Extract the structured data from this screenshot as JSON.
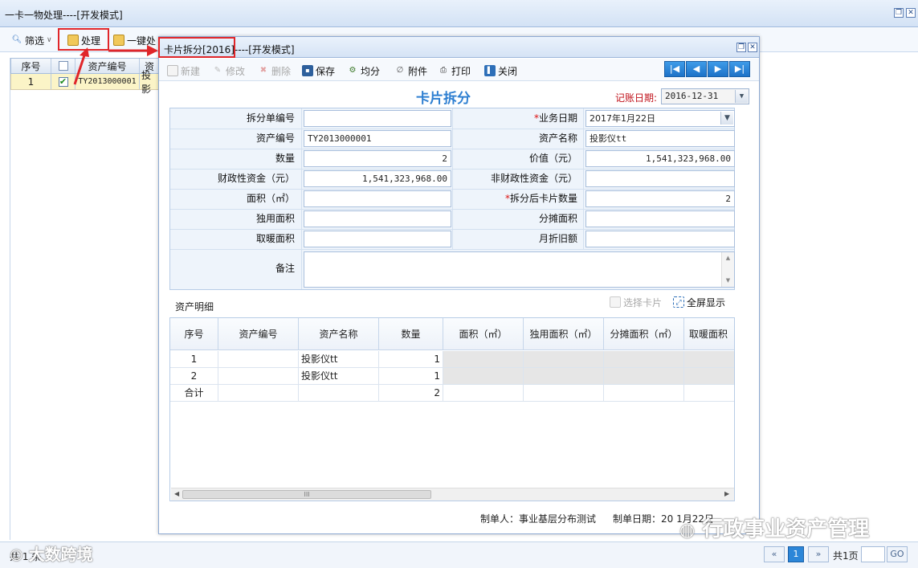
{
  "bg_window": {
    "title": "一卡一物处理----[开发模式]",
    "toolbar": {
      "filter": "筛选",
      "process": "处理",
      "batch": "一键处"
    },
    "grid": {
      "headers": [
        "序号",
        "",
        "资产编号",
        "资"
      ],
      "row": {
        "index": "1",
        "asset_no": "TY2013000001",
        "name": "投影"
      }
    },
    "status": {
      "count": "共 1 条",
      "page": "1",
      "total_pages": "共1页",
      "go": "GO"
    }
  },
  "modal": {
    "title": "卡片拆分[2016]----[开发模式]",
    "toolbar": {
      "new": "新建",
      "edit": "修改",
      "delete": "删除",
      "save": "保存",
      "split_even": "均分",
      "attachment": "附件",
      "print": "打印",
      "close": "关闭"
    },
    "heading": "卡片拆分",
    "record_date_label": "记账日期:",
    "record_date": "2016-12-31",
    "form": {
      "split_no_label": "拆分单编号",
      "split_no": "",
      "biz_date_label": "业务日期",
      "biz_date": "2017年1月22日",
      "asset_no_label": "资产编号",
      "asset_no": "TY2013000001",
      "asset_name_label": "资产名称",
      "asset_name": "投影仪tt",
      "qty_label": "数量",
      "qty": "2",
      "value_label": "价值（元）",
      "value": "1,541,323,968.00",
      "fiscal_label": "财政性资金（元）",
      "fiscal": "1,541,323,968.00",
      "nonfiscal_label": "非财政性资金（元）",
      "nonfiscal": "",
      "area_label": "面积（㎡）",
      "area": "",
      "split_count_label": "拆分后卡片数量",
      "split_count": "2",
      "own_area_label": "独用面积",
      "own_area": "",
      "shared_area_label": "分摊面积",
      "shared_area": "",
      "heat_area_label": "取暖面积",
      "heat_area": "",
      "monthly_dep_label": "月折旧额",
      "monthly_dep": "",
      "remark_label": "备注",
      "remark": ""
    },
    "detail": {
      "title": "资产明细",
      "select_card": "选择卡片",
      "fullscreen": "全屏显示",
      "headers": [
        "序号",
        "资产编号",
        "资产名称",
        "数量",
        "面积（㎡）",
        "独用面积（㎡）",
        "分摊面积（㎡）",
        "取暖面积（"
      ],
      "rows": [
        {
          "index": "1",
          "asset_no": "",
          "name": "投影仪tt",
          "qty": "1"
        },
        {
          "index": "2",
          "asset_no": "",
          "name": "投影仪tt",
          "qty": "1"
        }
      ],
      "total": {
        "label": "合计",
        "qty": "2"
      },
      "scroll_thumb": "III"
    },
    "footer": {
      "maker": "制单人：事业基层分布测试",
      "make_date": "制单日期：20  1月22日"
    }
  },
  "watermarks": {
    "left": "大数跨境",
    "right": "行政事业资产管理"
  }
}
